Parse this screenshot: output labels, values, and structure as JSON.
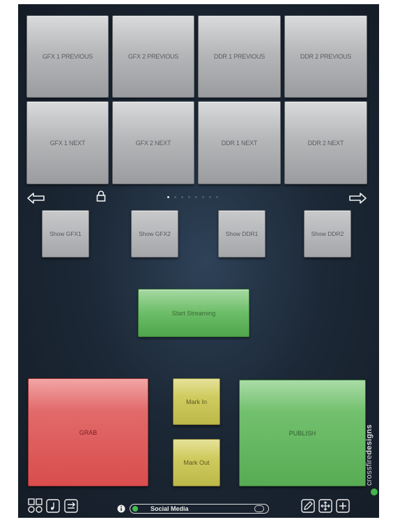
{
  "top_row": [
    "GFX 1 PREVIOUS",
    "GFX 2 PREVIOUS",
    "DDR 1 PREVIOUS",
    "DDR 2 PREVIOUS"
  ],
  "second_row": [
    "GFX 1 NEXT",
    "GFX 2 NEXT",
    "DDR 1 NEXT",
    "DDR 2 NEXT"
  ],
  "show_buttons": [
    "Show GFX1",
    "Show GFX2",
    "Show DDR1",
    "Show DDR2"
  ],
  "streaming": {
    "label": "Start Streaming"
  },
  "grab": {
    "label": "GRAB"
  },
  "mark_in": {
    "label": "Mark In"
  },
  "mark_out": {
    "label": "Mark Out"
  },
  "publish": {
    "label": "PUBLISH"
  },
  "page_indicator": {
    "count": 8,
    "active": 0
  },
  "status": {
    "title": "Social Media"
  },
  "brand": {
    "light": "crossfire",
    "bold": "designs"
  },
  "icons": {
    "nav_left": "arrow-left-icon",
    "nav_right": "arrow-right-icon",
    "lock": "lock-icon",
    "info": "info-icon",
    "edit": "pencil-icon",
    "move": "move-icon",
    "add": "plus-icon"
  },
  "colors": {
    "grab": "#d94d4d",
    "publish": "#57ac53",
    "mark": "#cfcb5e",
    "stream": "#6bbd67",
    "background": "#1c2836"
  }
}
